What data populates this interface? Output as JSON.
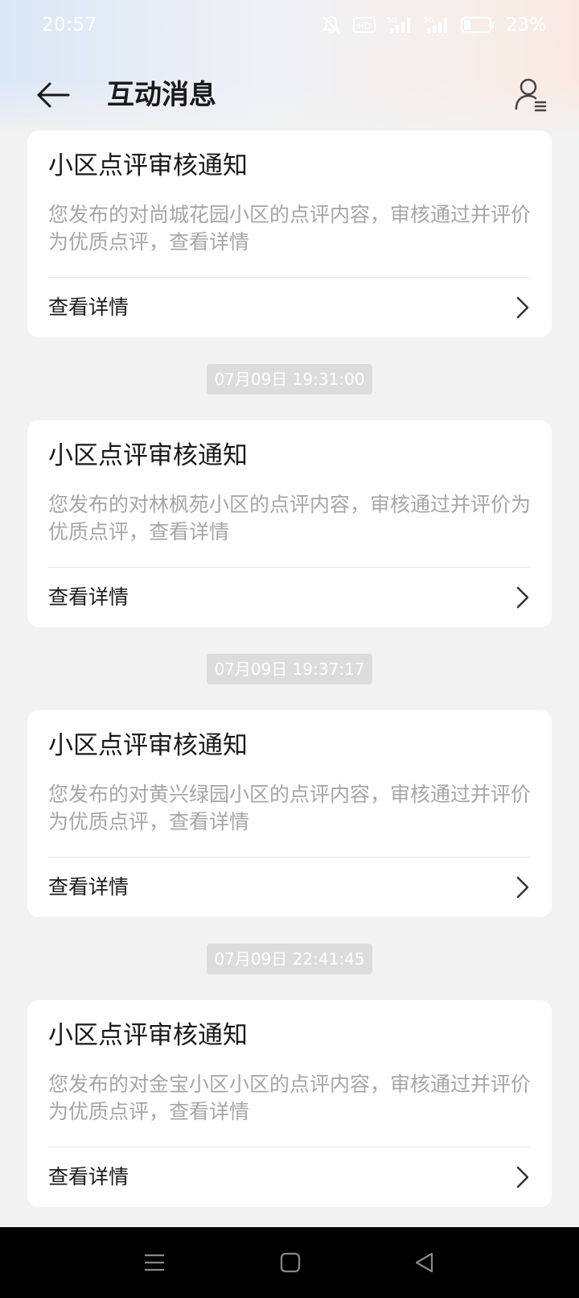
{
  "status_bar": {
    "time": "20:57",
    "battery_percent": "23%",
    "icons": [
      "mute-icon",
      "hd-icon",
      "signal-5g-icon",
      "signal-5g-icon",
      "battery-icon"
    ]
  },
  "header": {
    "title": "互动消息",
    "back_icon": "arrow-left-icon",
    "profile_icon": "user-list-icon"
  },
  "notifications": [
    {
      "title": "小区点评审核通知",
      "body": "您发布的对尚城花园小区的点评内容，审核通过并评价为优质点评，查看详情",
      "link_label": "查看详情"
    },
    {
      "timestamp": "07月09日 19:31:00",
      "title": "小区点评审核通知",
      "body": "您发布的对林枫苑小区的点评内容，审核通过并评价为优质点评，查看详情",
      "link_label": "查看详情"
    },
    {
      "timestamp": "07月09日 19:37:17",
      "title": "小区点评审核通知",
      "body": "您发布的对黄兴绿园小区的点评内容，审核通过并评价为优质点评，查看详情",
      "link_label": "查看详情"
    },
    {
      "timestamp": "07月09日 22:41:45",
      "title": "小区点评审核通知",
      "body": "您发布的对金宝小区小区的点评内容，审核通过并评价为优质点评，查看详情",
      "link_label": "查看详情"
    }
  ],
  "nav_bar": {
    "buttons": [
      "menu-icon",
      "home-icon",
      "back-triangle-icon"
    ]
  },
  "colors": {
    "title_text": "#1a1a1a",
    "body_text": "#a6a6a6",
    "timestamp_bg": "#dcdcdc",
    "page_bg": "#f2f2f2"
  }
}
